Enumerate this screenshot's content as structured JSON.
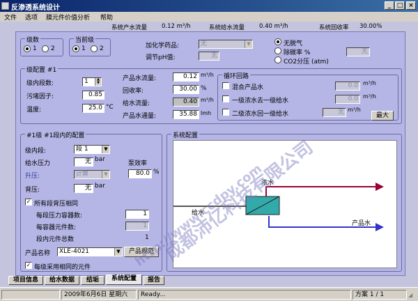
{
  "window": {
    "title": "反渗透系统设计"
  },
  "menu": [
    "文件",
    "选项",
    "膜元件价值分析",
    "帮助"
  ],
  "summary": {
    "product_flow_label": "系统产水流量",
    "product_flow_value": "0.12 m³/h",
    "feed_flow_label": "系统给水流量",
    "feed_flow_value": "0.40 m³/h",
    "recovery_label": "系统回收率",
    "recovery_value": "30.00%"
  },
  "stages": {
    "title": "级数",
    "opt1": "1",
    "opt2": "2",
    "selected": "1"
  },
  "current_stage": {
    "title": "当前级",
    "opt1": "1",
    "opt2": "2",
    "selected": "1"
  },
  "chemical": {
    "dose_label": "加化学药品:",
    "dose_value": "无",
    "ph_label": "调节pH值:",
    "ph_value": "无",
    "degas_none": "无脱气",
    "degas_co2_rate": "除碳率 %",
    "degas_co2_partial": "CO2分压 (atm)",
    "degas_value": "无"
  },
  "stage_config": {
    "title": "级配置 #1",
    "stages_in_label": "级内段数:",
    "stages_in_value": "1",
    "fouling_label": "污堵因子:",
    "fouling_value": "0.85",
    "temp_label": "温度:",
    "temp_value": "25.0",
    "temp_unit": "°C",
    "prod_flow_label": "产品水流量:",
    "prod_flow_value": "0.12",
    "prod_flow_unit": "m³/h",
    "recovery_label": "回收率:",
    "recovery_value": "30.00",
    "recovery_unit": "%",
    "feed_flow_label": "给水流量:",
    "feed_flow_value": "0.40",
    "feed_flow_unit": "m³/h",
    "flux_label": "产品水通量:",
    "flux_value": "35.88",
    "flux_unit": "lmh"
  },
  "recycle": {
    "title": "循环回路",
    "mix_label": "混合产品水",
    "mix_value": "0.0",
    "conc1_label": "一级浓水去一级给水",
    "conc1_value": "0.0",
    "conc2_label": "二级浓水回一级给水",
    "conc2_value": "无",
    "unit": "m³/h",
    "max_button": "最大"
  },
  "segment": {
    "title": "#1级 #1段内的配置",
    "seg_label": "级内段:",
    "seg_value": "段 1",
    "feed_pressure_label": "给水压力",
    "feed_pressure_value": "无",
    "bar": "bar",
    "pump_eff_label": "泵效率",
    "pump_eff_value": "80.0",
    "pct": "%",
    "boost_label": "升压:",
    "boost_value": "计算",
    "back_label": "背压:",
    "back_value": "无",
    "same_label": "所有段背压相同",
    "vessels_label": "每段压力容器数:",
    "vessels_value": "1",
    "elements_label": "每容器元件数:",
    "elements_value": "1",
    "total_label": "段内元件总数",
    "total_value": "1",
    "product_label": "产品名称",
    "product_value": "XLE-4021",
    "spec_button": "产品规范",
    "same_elem_label": "每级采用相同的元件"
  },
  "system_config": {
    "title": "系统配置",
    "feed_label": "给水",
    "conc_label": "浓水",
    "prod_label": "产品水",
    "concentrate_color": "#990033",
    "product_color": "#3333cc",
    "vessel_color": "#33aaaa"
  },
  "tabs": [
    "项目信息",
    "给水数据",
    "结垢",
    "系统配置",
    "报告"
  ],
  "active_tab": "系统配置",
  "status": {
    "date": "2009年6月6日 星期六",
    "state": "Ready...",
    "plan": "方案 1 / 1"
  },
  "watermark": {
    "text1": "成都沛亿科技有限公司",
    "text2": "http://www.ccdpy.com"
  }
}
